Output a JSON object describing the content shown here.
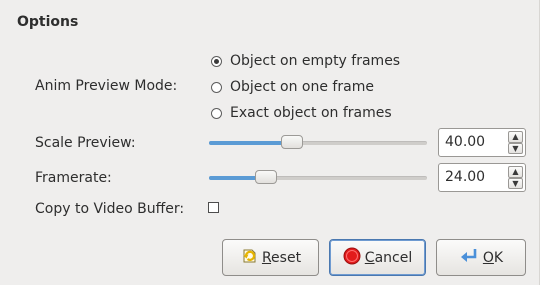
{
  "options": {
    "title": "Options",
    "anim_preview_label": "Anim Preview Mode:",
    "anim_modes": [
      {
        "label": "Object on empty frames",
        "selected": true
      },
      {
        "label": "Object on one frame",
        "selected": false
      },
      {
        "label": "Exact object on frames",
        "selected": false
      }
    ],
    "scale_preview_label": "Scale Preview:",
    "scale_preview_value": "40.00",
    "scale_preview_fraction": 0.38,
    "framerate_label": "Framerate:",
    "framerate_value": "24.00",
    "framerate_fraction": 0.26,
    "copy_to_video_buffer_label": "Copy to Video Buffer:",
    "copy_to_video_buffer_checked": false
  },
  "buttons": {
    "reset_mnemonic": "R",
    "reset_rest": "eset",
    "cancel_mnemonic": "C",
    "cancel_rest": "ancel",
    "ok_mnemonic": "O",
    "ok_rest": "K"
  },
  "icons": {
    "reset": "reset-icon",
    "cancel": "stop-icon",
    "ok": "ok-arrow-icon"
  },
  "colors": {
    "slider_fill": "#5b9bd5",
    "cancel_icon": "#e21b1b",
    "reset_icon": "#e6b400",
    "ok_icon": "#4a90d9"
  }
}
